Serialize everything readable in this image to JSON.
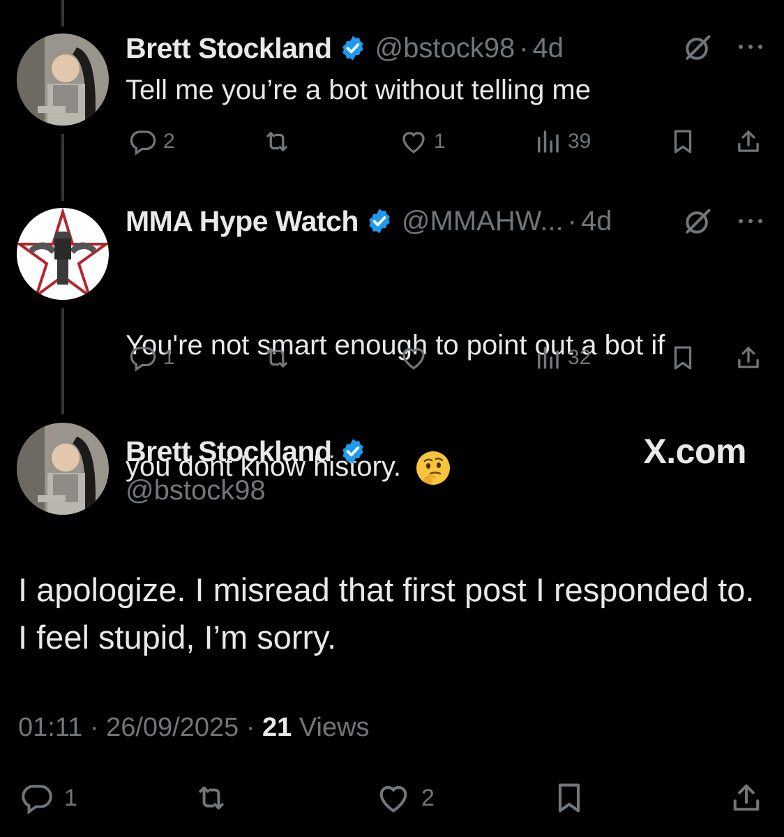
{
  "posts": [
    {
      "name": "Brett Stockland",
      "handle": "@bstock98",
      "time": "4d",
      "text": "Tell me you’re a bot without telling me",
      "replies": "2",
      "reposts": "",
      "likes": "1",
      "views": "39"
    },
    {
      "name": "MMA Hype Watch",
      "handle": "@MMAHW...",
      "time": "4d",
      "text_line1": "You're not smart enough to point out a bot if",
      "text_line2": "you dont know history.",
      "emoji": "thinking-face-emoji",
      "replies": "1",
      "reposts": "",
      "likes": "",
      "views": "32"
    }
  ],
  "focused": {
    "name": "Brett Stockland",
    "handle": "@bstock98",
    "watermark": "X.com",
    "text": "I apologize. I misread that first post I responded to. I feel stupid, I’m sorry.",
    "time": "01:11",
    "date": "26/09/2025",
    "views_count": "21",
    "views_label": "Views",
    "replies": "1",
    "reposts": "",
    "likes": "2"
  },
  "colors": {
    "background": "#000000",
    "text": "#e7e9ea",
    "muted": "#71767b",
    "verified": "#1d9bf0",
    "thread_line": "#333639"
  },
  "icons": [
    "reply-icon",
    "repost-icon",
    "like-icon",
    "views-icon",
    "bookmark-icon",
    "share-icon",
    "grok-icon",
    "more-icon",
    "verified-icon"
  ]
}
